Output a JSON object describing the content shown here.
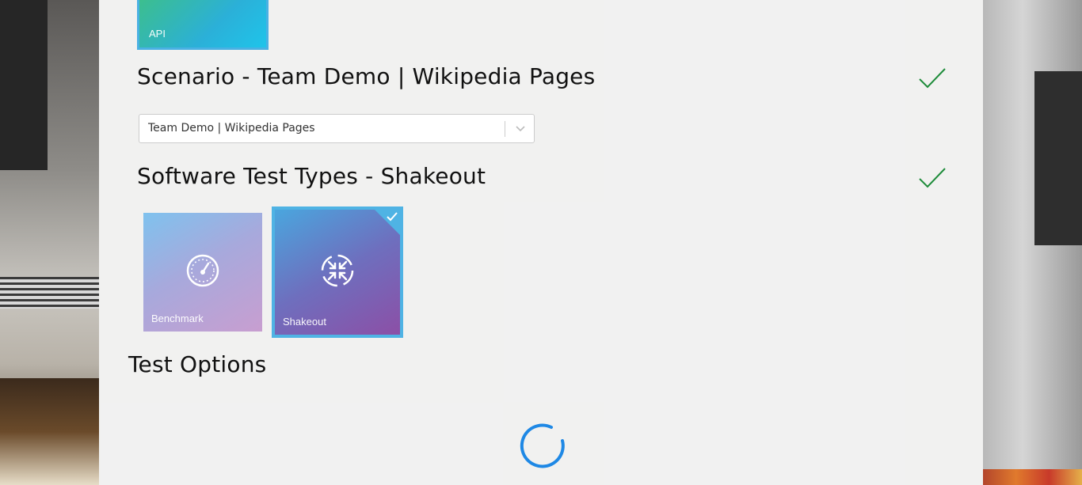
{
  "tiles_top": {
    "api_label": "API"
  },
  "scenario": {
    "title": "Scenario - Team Demo | Wikipedia Pages",
    "selected_value": "Team Demo | Wikipedia Pages"
  },
  "test_types": {
    "title": "Software Test Types - Shakeout",
    "tiles": [
      {
        "label": "Benchmark",
        "icon": "speedometer-icon",
        "selected": false
      },
      {
        "label": "Shakeout",
        "icon": "compress-arrows-icon",
        "selected": true
      }
    ]
  },
  "test_options": {
    "title": "Test Options"
  },
  "colors": {
    "accent_blue": "#4fb3e4",
    "check_green": "#1e8c3a",
    "spinner_blue": "#1e88e5"
  }
}
